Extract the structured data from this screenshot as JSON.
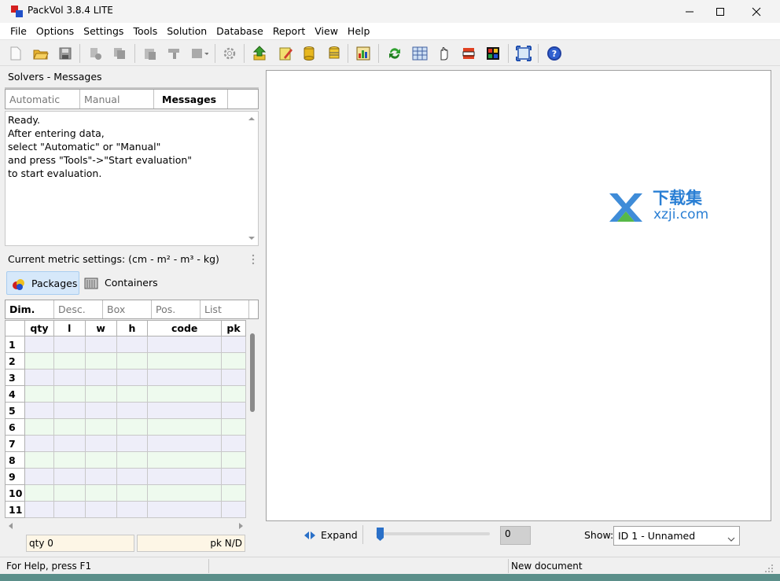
{
  "window": {
    "title": "PackVol 3.8.4 LITE"
  },
  "menu": [
    "File",
    "Options",
    "Settings",
    "Tools",
    "Solution",
    "Database",
    "Report",
    "View",
    "Help"
  ],
  "solvers": {
    "title": "Solvers - Messages",
    "tabs": [
      "Automatic",
      "Manual",
      "Messages"
    ],
    "active_tab": "Messages",
    "messages": [
      "Ready.",
      "After entering data,",
      "select \"Automatic\" or \"Manual\"",
      "and press \"Tools\"->\"Start evaluation\"",
      "to start evaluation."
    ]
  },
  "metric": {
    "label": "Current metric settings: (cm - m² - m³ - kg)"
  },
  "mode_tabs": {
    "packages": "Packages",
    "containers": "Containers"
  },
  "sub_tabs": [
    "Dim.",
    "Desc.",
    "Box",
    "Pos.",
    "List"
  ],
  "grid": {
    "columns": [
      "qty",
      "l",
      "w",
      "h",
      "code",
      "pk"
    ],
    "rows": [
      "1",
      "2",
      "3",
      "4",
      "5",
      "6",
      "7",
      "8",
      "9",
      "10",
      "11"
    ]
  },
  "footer_fields": {
    "qty": "qty 0",
    "pk": "pk N/D"
  },
  "view_controls": {
    "expand_label": "Expand",
    "slider_value": "0",
    "show_label": "Show:",
    "show_selected": "ID 1 - Unnamed"
  },
  "watermark": {
    "cn": "下载集",
    "domain": "xzji.com"
  },
  "status": {
    "help": "For Help, press F1",
    "doc": "New document"
  },
  "colors": {
    "accent": "#3a7bd5",
    "row_odd": "#eeeef9",
    "row_even": "#eefaee",
    "watermark_blue": "#2a7fd4",
    "watermark_green": "#57b947"
  }
}
